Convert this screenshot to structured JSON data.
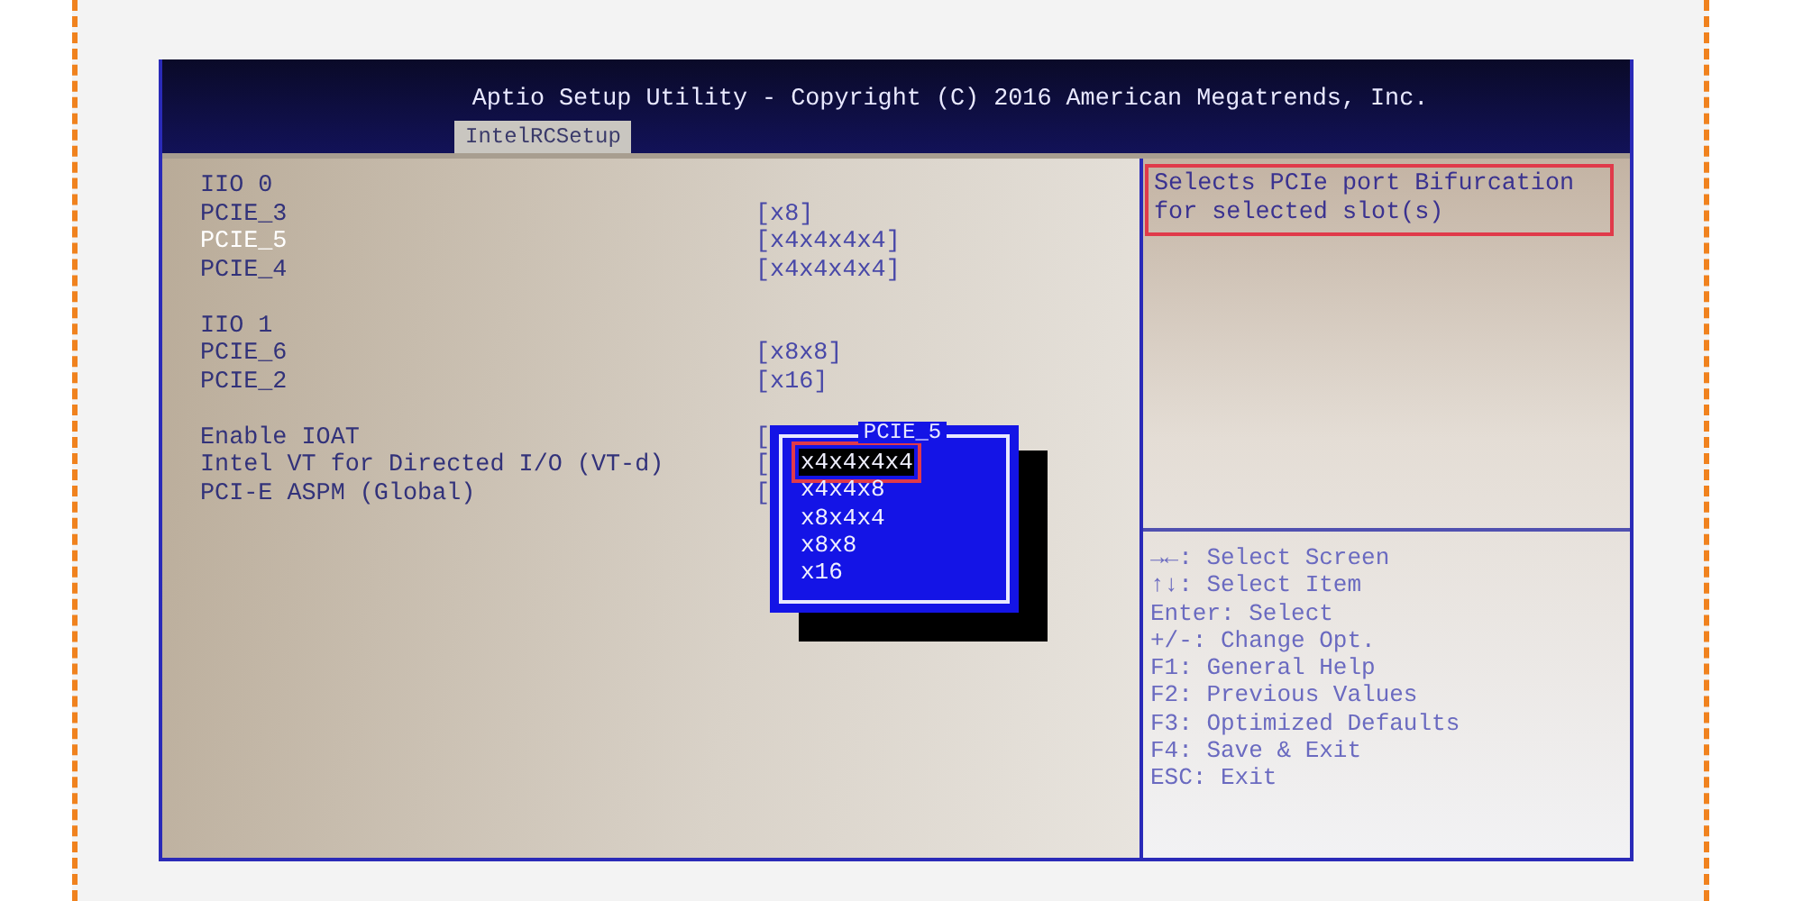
{
  "window": {
    "title": "Aptio Setup Utility - Copyright (C) 2016 American Megatrends, Inc."
  },
  "tabs": [
    {
      "label": "IntelRCSetup",
      "selected": true
    }
  ],
  "groups": [
    {
      "header": "IIO 0",
      "items": [
        {
          "label": "PCIE_3",
          "value": "[x8]",
          "selected": false
        },
        {
          "label": "PCIE_5",
          "value": "[x4x4x4x4]",
          "selected": true
        },
        {
          "label": "PCIE_4",
          "value": "[x4x4x4x4]",
          "selected": false
        }
      ]
    },
    {
      "header": "IIO 1",
      "items": [
        {
          "label": "PCIE_6",
          "value": "[x8x8]",
          "selected": false
        },
        {
          "label": "PCIE_2",
          "value": "[x16]",
          "selected": false
        }
      ]
    },
    {
      "items": [
        {
          "label": "Enable IOAT",
          "value": "[",
          "selected": false
        },
        {
          "label": "Intel VT for Directed I/O (VT-d)",
          "value": "[",
          "selected": false
        },
        {
          "label": "PCI-E ASPM (Global)",
          "value": "[",
          "selected": false
        }
      ]
    }
  ],
  "popup": {
    "title": "PCIE_5",
    "options": [
      {
        "label": "x4x4x4x4",
        "selected": true,
        "highlighted": true
      },
      {
        "label": "x4x4x8",
        "selected": false,
        "highlighted": false
      },
      {
        "label": "x8x4x4",
        "selected": false,
        "highlighted": false
      },
      {
        "label": "x8x8",
        "selected": false,
        "highlighted": false
      },
      {
        "label": "x16",
        "selected": false,
        "highlighted": false
      }
    ]
  },
  "help": {
    "text": "Selects PCIe port Bifurcation for selected slot(s)",
    "highlighted": true
  },
  "key_help": [
    "→←: Select Screen",
    "↑↓: Select Item",
    "Enter: Select",
    "+/-: Change Opt.",
    "F1: General Help",
    "F2: Previous Values",
    "F3: Optimized Defaults",
    "F4: Save & Exit",
    "ESC: Exit"
  ]
}
